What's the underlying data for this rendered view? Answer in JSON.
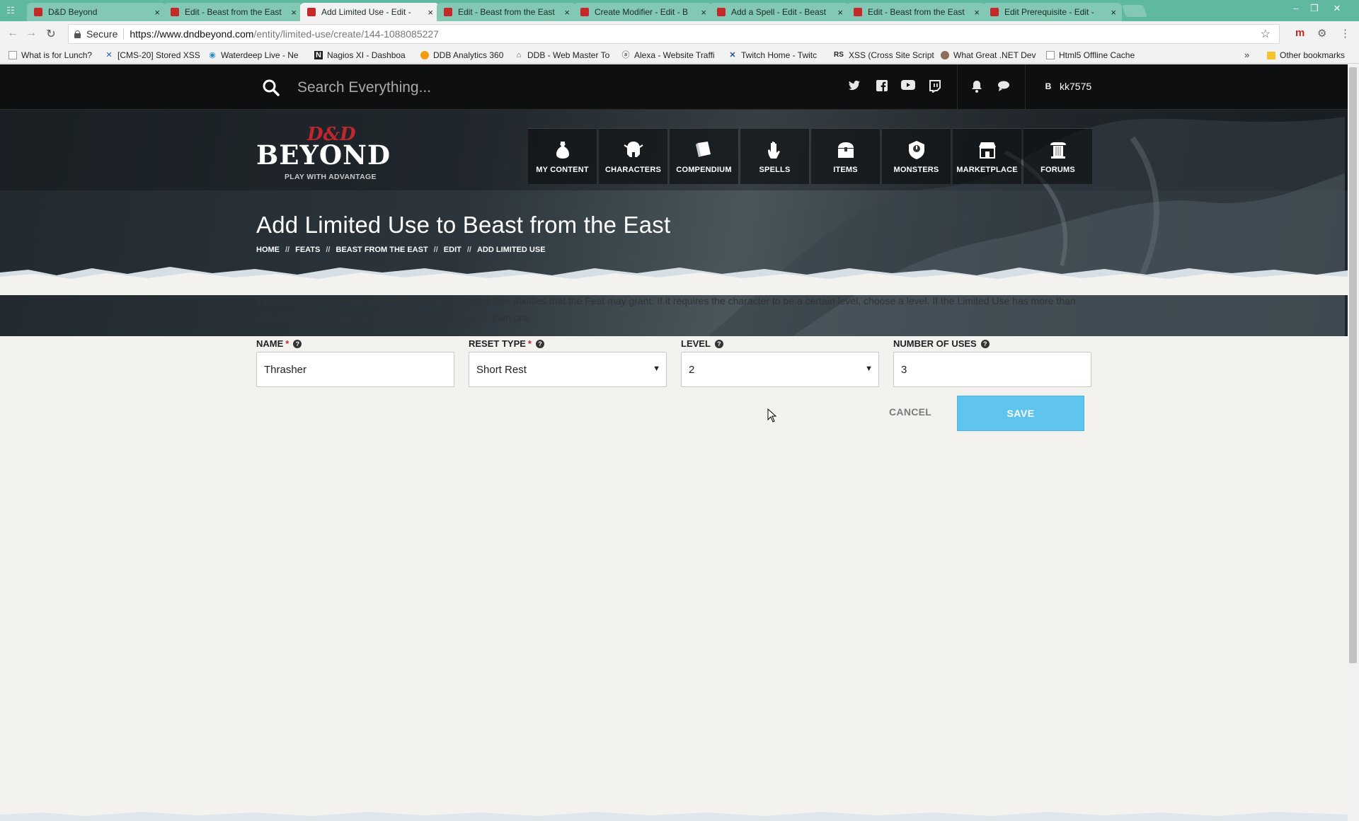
{
  "browser": {
    "tabs": [
      {
        "title": "D&D Beyond",
        "active": false
      },
      {
        "title": "Edit - Beast from the East",
        "active": false
      },
      {
        "title": "Add Limited Use - Edit -",
        "active": true
      },
      {
        "title": "Edit - Beast from the East",
        "active": false
      },
      {
        "title": "Create Modifier - Edit - B",
        "active": false
      },
      {
        "title": "Add a Spell - Edit - Beast",
        "active": false
      },
      {
        "title": "Edit - Beast from the East",
        "active": false
      },
      {
        "title": "Edit Prerequisite - Edit -",
        "active": false
      }
    ],
    "secure_label": "Secure",
    "url_host": "https://www.dndbeyond.com",
    "url_path": "/entity/limited-use/create/144-1088085227",
    "bookmarks": [
      {
        "label": "What is for Lunch?",
        "icon": "page-icon"
      },
      {
        "label": "[CMS-20] Stored XSS",
        "icon": "jira-icon"
      },
      {
        "label": "Waterdeep Live - Ne",
        "icon": "globe-icon"
      },
      {
        "label": "Nagios XI - Dashboa",
        "icon": "nagios-icon"
      },
      {
        "label": "DDB Analytics 360",
        "icon": "analytics-icon"
      },
      {
        "label": "DDB - Web Master To",
        "icon": "webmaster-icon"
      },
      {
        "label": "Alexa - Website Traffi",
        "icon": "alexa-icon"
      },
      {
        "label": "Twitch Home - Twitc",
        "icon": "twitch-icon"
      },
      {
        "label": "XSS (Cross Site Script",
        "icon": "rs-icon"
      },
      {
        "label": "What Great .NET Dev",
        "icon": "avatar-icon"
      },
      {
        "label": "Html5 Offline Cache",
        "icon": "page-icon"
      }
    ],
    "bookmarks_more": "»",
    "other_bookmarks": "Other bookmarks"
  },
  "site": {
    "search_placeholder": "Search Everything...",
    "user_initial": "B",
    "username": "kk7575",
    "logo_top": "D&D",
    "logo_main": "BEYOND",
    "logo_tagline": "PLAY WITH ADVANTAGE",
    "nav": [
      {
        "label": "MY CONTENT",
        "icon": "bag-icon"
      },
      {
        "label": "CHARACTERS",
        "icon": "helmet-icon"
      },
      {
        "label": "COMPENDIUM",
        "icon": "book-icon"
      },
      {
        "label": "SPELLS",
        "icon": "hand-icon"
      },
      {
        "label": "ITEMS",
        "icon": "chest-icon"
      },
      {
        "label": "MONSTERS",
        "icon": "shield-icon"
      },
      {
        "label": "MARKETPLACE",
        "icon": "store-icon"
      },
      {
        "label": "FORUMS",
        "icon": "pillar-icon"
      }
    ]
  },
  "page": {
    "title": "Add Limited Use to Beast from the East",
    "breadcrumb": [
      "HOME",
      "FEATS",
      "BEAST FROM THE EAST",
      "EDIT",
      "ADD LIMITED USE"
    ],
    "breadcrumb_sep": "//",
    "intro": "Input a Name and select a Reset Type for the Limited Use abilities that the Feat may grant. If it requires the character to be a certain level, choose a level. If the Limited Use has more than one use per reset, specific a Number of Uses greater than one."
  },
  "form": {
    "name": {
      "label": "NAME",
      "value": "Thrasher",
      "required": true
    },
    "reset_type": {
      "label": "RESET TYPE",
      "value": "Short Rest",
      "required": true
    },
    "level": {
      "label": "LEVEL",
      "value": "2"
    },
    "number_of_uses": {
      "label": "NUMBER OF USES",
      "value": "3"
    },
    "required_mark": "*",
    "help_glyph": "?",
    "cancel_label": "CANCEL",
    "save_label": "SAVE"
  },
  "colors": {
    "tabstrip": "#5fb8a0",
    "brand_red": "#c0272d",
    "save_button": "#5fc5ee"
  }
}
